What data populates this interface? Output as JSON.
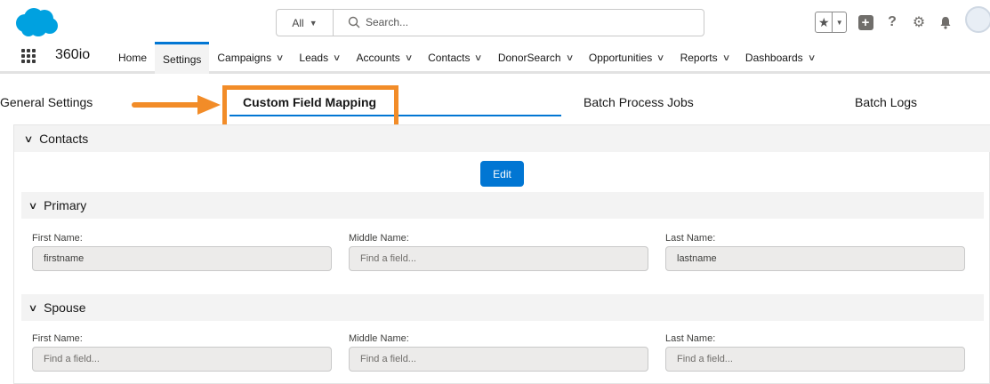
{
  "header": {
    "search_scope": "All",
    "search_placeholder": "Search..."
  },
  "nav": {
    "app_name": "360io",
    "items": [
      {
        "label": "Home",
        "chevron": false
      },
      {
        "label": "Settings",
        "chevron": false,
        "active": true
      },
      {
        "label": "Campaigns",
        "chevron": true
      },
      {
        "label": "Leads",
        "chevron": true
      },
      {
        "label": "Accounts",
        "chevron": true
      },
      {
        "label": "Contacts",
        "chevron": true
      },
      {
        "label": "DonorSearch",
        "chevron": true
      },
      {
        "label": "Opportunities",
        "chevron": true
      },
      {
        "label": "Reports",
        "chevron": true
      },
      {
        "label": "Dashboards",
        "chevron": true
      }
    ]
  },
  "tabs": {
    "general": "General Settings",
    "mapping": "Custom Field Mapping",
    "batch_jobs": "Batch Process Jobs",
    "batch_logs": "Batch Logs"
  },
  "contacts": {
    "title": "Contacts",
    "edit_label": "Edit",
    "primary": {
      "title": "Primary",
      "first_label": "First Name:",
      "first_value": "firstname",
      "middle_label": "Middle Name:",
      "middle_placeholder": "Find a field...",
      "last_label": "Last Name:",
      "last_value": "lastname"
    },
    "spouse": {
      "title": "Spouse",
      "first_label": "First Name:",
      "first_placeholder": "Find a field...",
      "middle_label": "Middle Name:",
      "middle_placeholder": "Find a field...",
      "last_label": "Last Name:",
      "last_placeholder": "Find a field..."
    }
  },
  "colors": {
    "brand_blue": "#0176d3",
    "highlight_orange": "#f28c28",
    "section_bg": "#f3f3f3"
  }
}
